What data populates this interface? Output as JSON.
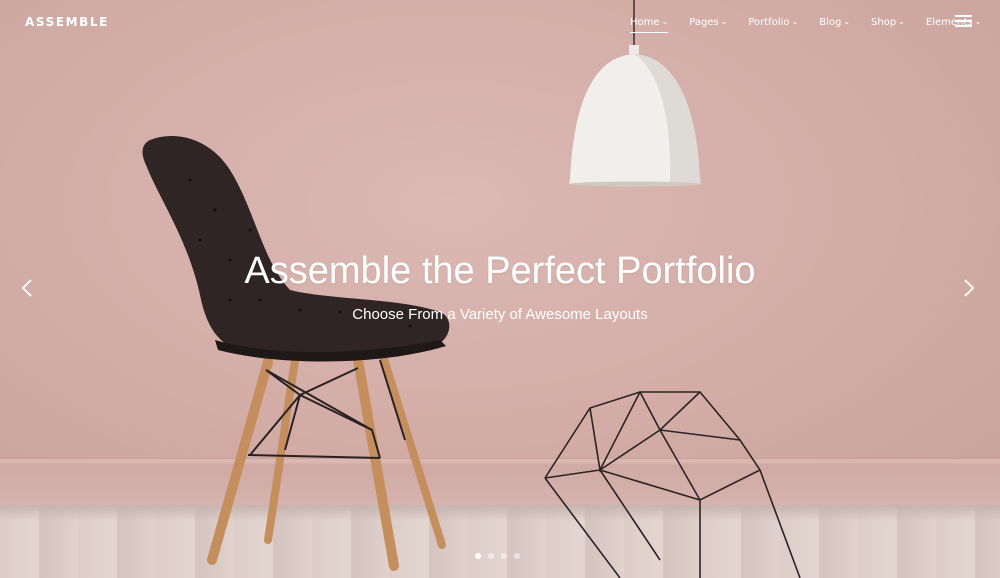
{
  "brand": {
    "name": "ASSEMBLE"
  },
  "nav": {
    "items": [
      {
        "label": "Home",
        "active": true
      },
      {
        "label": "Pages"
      },
      {
        "label": "Portfolio"
      },
      {
        "label": "Blog"
      },
      {
        "label": "Shop"
      },
      {
        "label": "Elements"
      }
    ],
    "chevron": "⌄",
    "menu_icon": "hamburger-icon"
  },
  "slider": {
    "title": "Assemble the Perfect Portfolio",
    "subtitle": "Choose From a Variety of Awesome Layouts",
    "prev_icon": "chevron-left-icon",
    "next_icon": "chevron-right-icon",
    "slide_count": 4,
    "active_slide": 1
  },
  "colors": {
    "wall": "#d6b1ab",
    "text": "#ffffff",
    "chair": "#2e2424",
    "wood": "#c99563"
  }
}
